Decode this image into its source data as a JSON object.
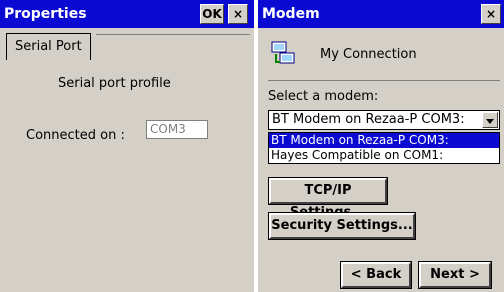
{
  "left_window": {
    "title": "Properties",
    "ok_label": "OK",
    "close_label": "×",
    "tab": "Serial Port",
    "profile_label": "Serial port profile",
    "connected_label": "Connected on :",
    "connected_value": "COM3"
  },
  "right_window": {
    "title": "Modem",
    "close_label": "×",
    "connection_name": "My Connection",
    "select_label": "Select a modem:",
    "selected_modem": "BT Modem on Rezaa-P COM3:",
    "options": [
      "BT Modem on Rezaa-P COM3:",
      "Hayes Compatible on COM1:"
    ],
    "tcpip_button": "TCP/IP Settings...",
    "security_button": "Security Settings...",
    "back_button": "< Back",
    "next_button": "Next >"
  }
}
